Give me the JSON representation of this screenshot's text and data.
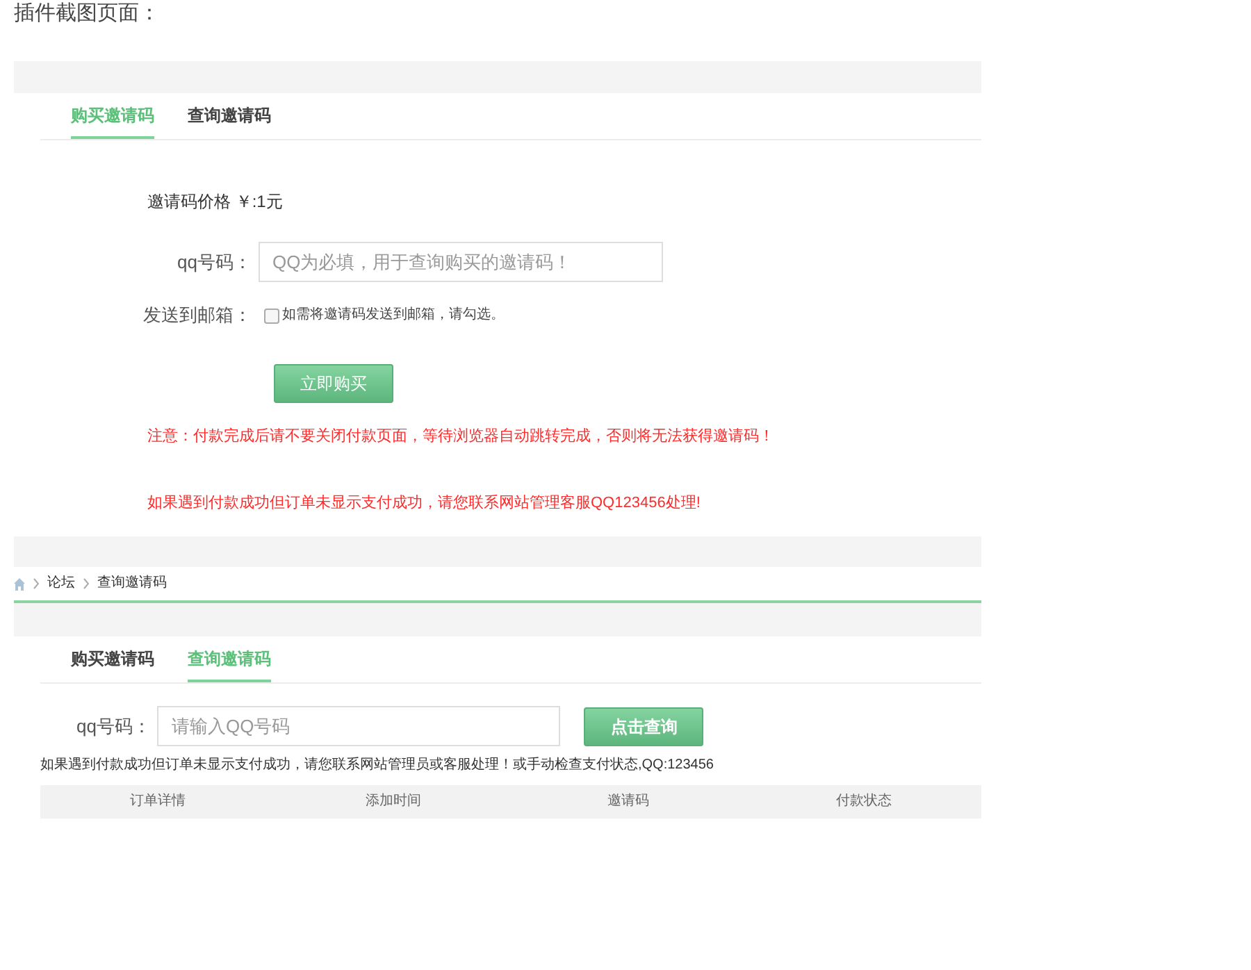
{
  "page_title": "插件截图页面：",
  "buy_panel": {
    "tabs": [
      {
        "label": "购买邀请码",
        "selected": true
      },
      {
        "label": "查询邀请码",
        "selected": false
      }
    ],
    "price": "邀请码价格 ￥:1元",
    "qq_field": {
      "label": "qq号码：",
      "placeholder": "QQ为必填，用于查询购买的邀请码！"
    },
    "email_option": {
      "label": "发送到邮箱：",
      "checked": false,
      "hint": "如需将邀请码发送到邮箱，请勾选。"
    },
    "buy_button": "立即购买",
    "notices": [
      "注意：付款完成后请不要关闭付款页面，等待浏览器自动跳转完成，否则将无法获得邀请码！",
      "如果遇到付款成功但订单未显示支付成功，请您联系网站管理客服QQ123456处理!"
    ]
  },
  "query_panel": {
    "breadcrumb": [
      "论坛",
      "查询邀请码"
    ],
    "tabs": [
      {
        "label": "购买邀请码",
        "selected": false
      },
      {
        "label": "查询邀请码",
        "selected": true
      }
    ],
    "qq_field": {
      "label": "qq号码：",
      "placeholder": "请输入QQ号码"
    },
    "query_button": "点击查询",
    "notice": "如果遇到付款成功但订单未显示支付成功，请您联系网站管理员或客服处理！或手动检查支付状态,QQ:123456",
    "table": {
      "columns": [
        "订单详情",
        "添加时间",
        "邀请码",
        "付款状态"
      ]
    }
  }
}
